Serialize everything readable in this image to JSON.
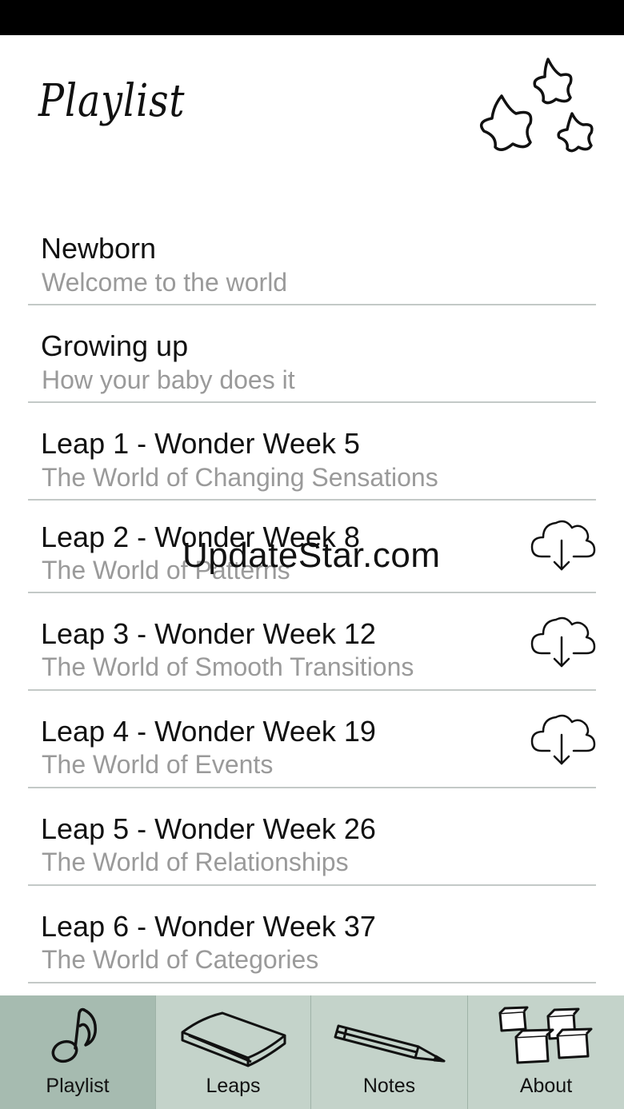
{
  "header": {
    "title": "Playlist",
    "decoration_icon": "stars-doodle-icon"
  },
  "playlist": {
    "items": [
      {
        "title": "Newborn",
        "subtitle": "Welcome to the world",
        "download": false
      },
      {
        "title": "Growing up",
        "subtitle": "How your baby does it",
        "download": false
      },
      {
        "title": "Leap 1 - Wonder Week 5",
        "subtitle": "The World of Changing Sensations",
        "download": false
      },
      {
        "title": "Leap 2 - Wonder Week 8",
        "subtitle": "The World of Patterns",
        "download": true,
        "icon": "cloud-download-icon"
      },
      {
        "title": "Leap 3 - Wonder Week 12",
        "subtitle": "The World of Smooth Transitions",
        "download": true,
        "icon": "cloud-download-icon"
      },
      {
        "title": "Leap 4 - Wonder Week 19",
        "subtitle": "The World of Events",
        "download": true,
        "icon": "cloud-download-icon"
      },
      {
        "title": "Leap 5 - Wonder Week 26",
        "subtitle": "The World of Relationships",
        "download": false
      },
      {
        "title": "Leap 6 - Wonder Week 37",
        "subtitle": "The World of Categories",
        "download": false
      }
    ]
  },
  "watermark": "UpdateStar.com",
  "tabbar": {
    "tabs": [
      {
        "label": "Playlist",
        "icon": "music-note-icon",
        "active": true
      },
      {
        "label": "Leaps",
        "icon": "book-icon",
        "active": false
      },
      {
        "label": "Notes",
        "icon": "pencil-icon",
        "active": false
      },
      {
        "label": "About",
        "icon": "blocks-icon",
        "active": false
      }
    ]
  },
  "colors": {
    "status_bar": "#000000",
    "tabbar_bg": "#c4d3ca",
    "tab_active_bg": "#a6bbb0",
    "divider": "#c3c9c7",
    "subtitle": "#9a9a9a"
  }
}
